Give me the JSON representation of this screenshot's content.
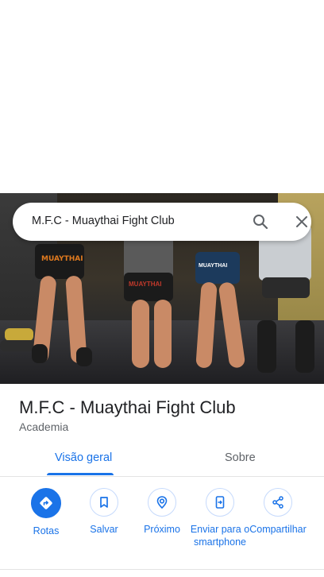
{
  "search": {
    "query": "M.F.C - Muaythai Fight Club"
  },
  "place": {
    "name": "M.F.C - Muaythai Fight Club",
    "category": "Academia"
  },
  "tabs": [
    {
      "label": "Visão geral",
      "active": true
    },
    {
      "label": "Sobre",
      "active": false
    }
  ],
  "actions": [
    {
      "label": "Rotas",
      "icon": "directions-icon",
      "primary": true
    },
    {
      "label": "Salvar",
      "icon": "bookmark-icon"
    },
    {
      "label": "Próximo",
      "icon": "nearby-icon"
    },
    {
      "label": "Enviar para o smartphone",
      "icon": "send-to-phone-icon"
    },
    {
      "label": "Compartilhar",
      "icon": "share-icon"
    }
  ],
  "hero": {
    "shorts_labels": [
      "MUAYTHAI",
      "MUAYTHAI",
      "MUAYTHAI"
    ]
  },
  "colors": {
    "accent": "#1a73e8",
    "text_primary": "#202124",
    "text_secondary": "#5f6368"
  }
}
